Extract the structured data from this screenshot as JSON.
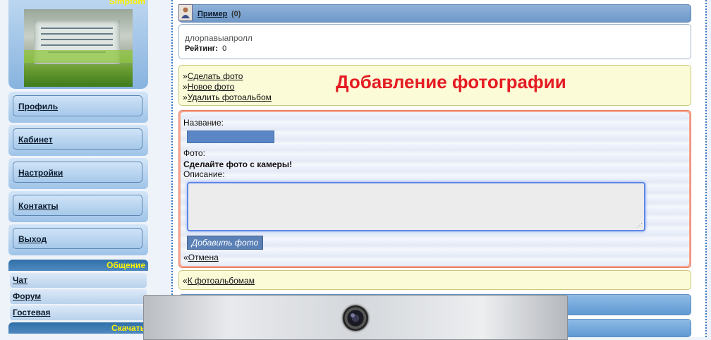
{
  "sidebar": {
    "brand": "Simptom",
    "menu": [
      "Профиль",
      "Кабинет",
      "Настройки",
      "Контакты",
      "Выход"
    ],
    "section_social": "Общение",
    "social_links": [
      "Чат",
      "Форум",
      "Гостевая"
    ],
    "section_download": "Скачать"
  },
  "user": {
    "name": "Пример",
    "count": "(0)"
  },
  "status": {
    "text": "длорпавыапролл",
    "rating_label": "Рейтинг:",
    "rating_value": "0"
  },
  "actions": {
    "prefix": "»",
    "links": [
      "Сделать фото",
      "Новое фото",
      "Удалить фотоальбом"
    ],
    "heading": "Добавление фотографии"
  },
  "form": {
    "name_label": "Название:",
    "name_value": "",
    "photo_label": "Фото:",
    "camera_notice": "Сделайте фото с камеры!",
    "desc_label": "Описание:",
    "desc_value": "",
    "submit_label": "Добавить фото",
    "cancel_prefix": "«",
    "cancel_label": "Отмена"
  },
  "back": {
    "prefix": "«",
    "label": "К фотоальбомам"
  },
  "colors": {
    "heading": "#e51c23",
    "brand": "#fff200",
    "accent": "#5a80b6"
  },
  "icons": [
    "avatar-icon",
    "camera-lens-icon"
  ]
}
